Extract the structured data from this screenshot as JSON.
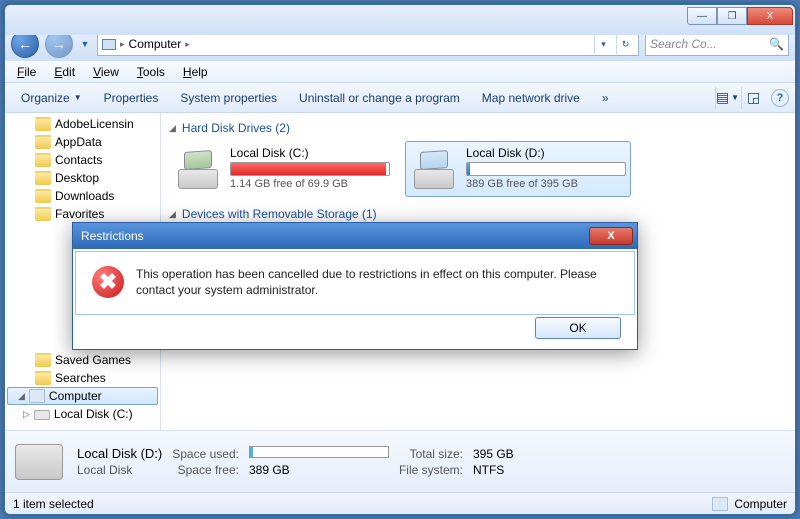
{
  "window": {
    "min": "—",
    "max": "❐",
    "close": "X"
  },
  "nav": {
    "crumb_root_icon": "🖥",
    "crumb_label": "Computer",
    "search_placeholder": "Search Co...",
    "search_icon": "🔍"
  },
  "menu": {
    "file": "File",
    "edit": "Edit",
    "view": "View",
    "tools": "Tools",
    "help": "Help"
  },
  "toolbar": {
    "organize": "Organize",
    "properties": "Properties",
    "sysprops": "System properties",
    "uninstall": "Uninstall or change a program",
    "mapdrive": "Map network drive",
    "more": "»"
  },
  "tree": {
    "items": [
      "AdobeLicensin",
      "AppData",
      "Contacts",
      "Desktop",
      "Downloads",
      "Favorites"
    ],
    "items2": [
      "Saved Games",
      "Searches"
    ],
    "computer": "Computer",
    "localc": "Local Disk (C:)"
  },
  "groups": {
    "hdd": "Hard Disk Drives (2)",
    "removable": "Devices with Removable Storage (1)"
  },
  "drives": {
    "c": {
      "name": "Local Disk (C:)",
      "free": "1.14 GB free of 69.9 GB"
    },
    "d": {
      "name": "Local Disk (D:)",
      "free": "389 GB free of 395 GB"
    }
  },
  "details": {
    "title": "Local Disk (D:)",
    "type": "Local Disk",
    "k_used": "Space used:",
    "k_free": "Space free:",
    "v_free": "389 GB",
    "k_total": "Total size:",
    "v_total": "395 GB",
    "k_fs": "File system:",
    "v_fs": "NTFS"
  },
  "status": {
    "left": "1 item selected",
    "right": "Computer"
  },
  "dialog": {
    "title": "Restrictions",
    "message": "This operation has been cancelled due to restrictions in effect on this computer. Please contact your system administrator.",
    "ok": "OK",
    "x": "X"
  }
}
